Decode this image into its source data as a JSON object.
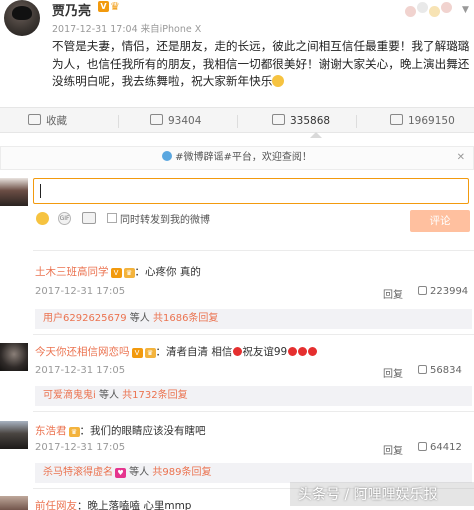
{
  "post": {
    "author": "贾乃亮",
    "vip_badge": "V",
    "timestamp": "2017-12-31 17:04",
    "source_prefix": "来自",
    "source": "iPhone X",
    "text": "不管是夫妻，情侣，还是朋友，走的长远，彼此之间相互信任最重要！我了解璐璐为人，也信任我所有的朋友，我相信一切都很美好！谢谢大家关心，晚上演出舞还没练明白呢，我去练舞啦，祝大家新年快乐"
  },
  "actions": {
    "favorite_label": "收藏",
    "share_count": "93404",
    "comment_count": "335868",
    "like_count": "1969150"
  },
  "compose": {
    "notice": "#微博辟谣#平台，欢迎查阅！",
    "forward_label": "同时转发到我的微博",
    "submit_label": "评论"
  },
  "comments": [
    {
      "user": "土木三班高同学",
      "text": "：心疼你 真的",
      "time": "2017-12-31 17:05",
      "reply_label": "回复",
      "likes": "223994",
      "subreply_user": "用户6292625679",
      "subreply_text": " 等人 ",
      "subreply_total": "共1686条回复"
    },
    {
      "user": "今天你还相信网恋吗",
      "text": "：清者自清 相信",
      "text_suffix": "祝友谊99",
      "time": "2017-12-31 17:05",
      "reply_label": "回复",
      "likes": "56834",
      "subreply_user": "可爱滴鬼鬼i",
      "subreply_text": " 等人 ",
      "subreply_total": "共1732条回复"
    },
    {
      "user": "东浩君",
      "text": "：我们的眼睛应该没有瞎吧",
      "time": "2017-12-31 17:05",
      "reply_label": "回复",
      "likes": "64412",
      "subreply_user": "杀马特滚得虚名",
      "subreply_text": " 等人 ",
      "subreply_total": "共989条回复"
    },
    {
      "user": "前任网友",
      "text": "：晚上落嗑嗑 心里mmp"
    }
  ],
  "watermark": "头条号 / 阿哩哩娱乐报",
  "colors": {
    "accent": "#eb7350",
    "vip": "#f29a0e",
    "submit_disabled": "#ffc09f",
    "heart": "#e52f2f"
  },
  "icons": [
    "avatar",
    "vip-badge-icon",
    "crown-icon",
    "chevron-down-icon",
    "favorite-icon",
    "share-icon",
    "comment-icon",
    "like-icon",
    "info-icon",
    "close-icon",
    "emoji-icon",
    "gif-icon",
    "image-icon",
    "checkbox",
    "heart-icon",
    "thumb-up-icon"
  ]
}
